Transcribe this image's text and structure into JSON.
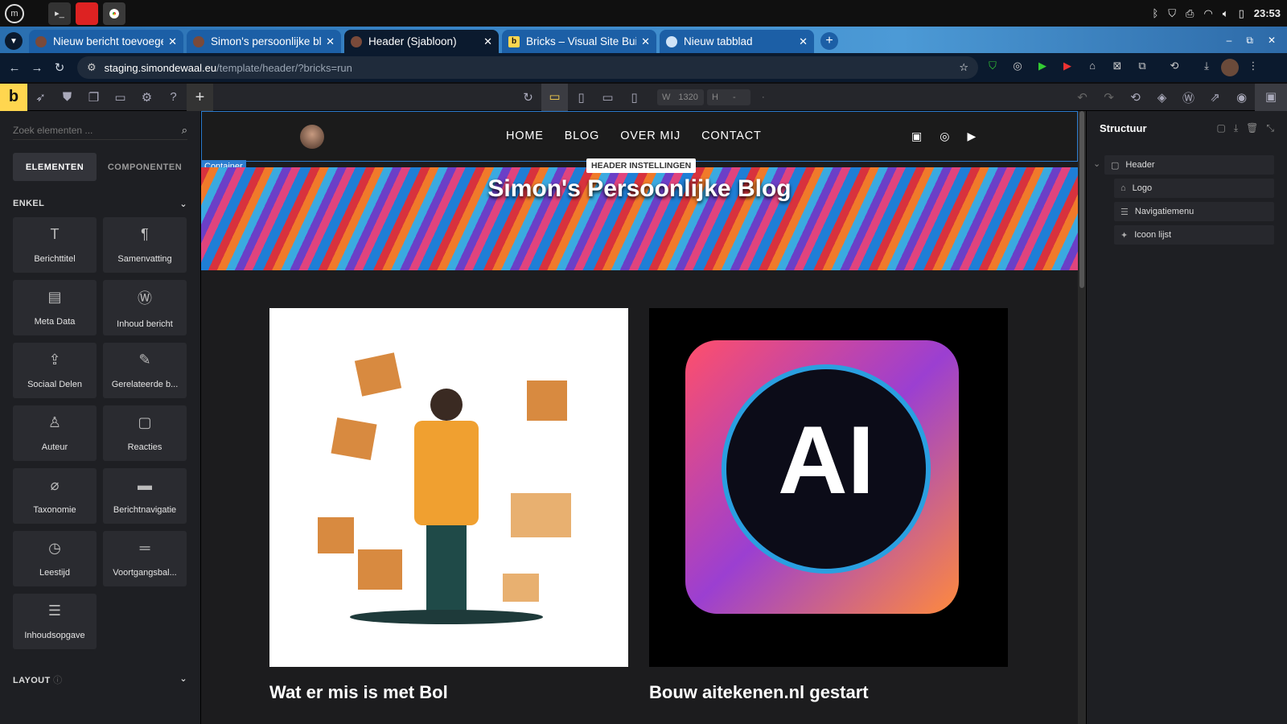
{
  "taskbar": {
    "clock": "23:53"
  },
  "tabs": [
    {
      "title": "Nieuw bericht toevoegen"
    },
    {
      "title": "Simon's persoonlijke blog"
    },
    {
      "title": "Header (Sjabloon)"
    },
    {
      "title": "Bricks – Visual Site Builder"
    },
    {
      "title": "Nieuw tabblad"
    }
  ],
  "address": {
    "host": "staging.simondewaal.eu",
    "path": "/template/header/?bricks=run"
  },
  "toolbar": {
    "width_label": "W",
    "width_value": "1320",
    "height_label": "H",
    "height_value": "-"
  },
  "left": {
    "search_placeholder": "Zoek elementen ...",
    "tab_elements": "ELEMENTEN",
    "tab_components": "COMPONENTEN",
    "section_simple": "ENKEL",
    "section_layout": "LAYOUT",
    "elements": [
      {
        "label": "Berichttitel",
        "icon": "T"
      },
      {
        "label": "Samenvatting",
        "icon": "¶"
      },
      {
        "label": "Meta Data",
        "icon": "▤"
      },
      {
        "label": "Inhoud bericht",
        "icon": "Ⓦ"
      },
      {
        "label": "Sociaal Delen",
        "icon": "⇪"
      },
      {
        "label": "Gerelateerde b...",
        "icon": "✎"
      },
      {
        "label": "Auteur",
        "icon": "♙"
      },
      {
        "label": "Reacties",
        "icon": "▢"
      },
      {
        "label": "Taxonomie",
        "icon": "⌀"
      },
      {
        "label": "Berichtnavigatie",
        "icon": "▬"
      },
      {
        "label": "Leestijd",
        "icon": "◷"
      },
      {
        "label": "Voortgangsbal...",
        "icon": "═"
      },
      {
        "label": "Inhoudsopgave",
        "icon": "☰"
      }
    ]
  },
  "canvas": {
    "menu": [
      "HOME",
      "BLOG",
      "OVER MIJ",
      "CONTACT"
    ],
    "hero_title": "Simon's Persoonlijke Blog",
    "container_tag": "Container",
    "header_settings_tag": "HEADER INSTELLINGEN",
    "posts": [
      {
        "title": "Wat er mis is met Bol"
      },
      {
        "title": "Bouw aitekenen.nl gestart"
      }
    ]
  },
  "structure": {
    "title": "Structuur",
    "items": [
      {
        "label": "Header"
      },
      {
        "label": "Logo"
      },
      {
        "label": "Navigatiemenu"
      },
      {
        "label": "Icoon lijst"
      }
    ]
  }
}
